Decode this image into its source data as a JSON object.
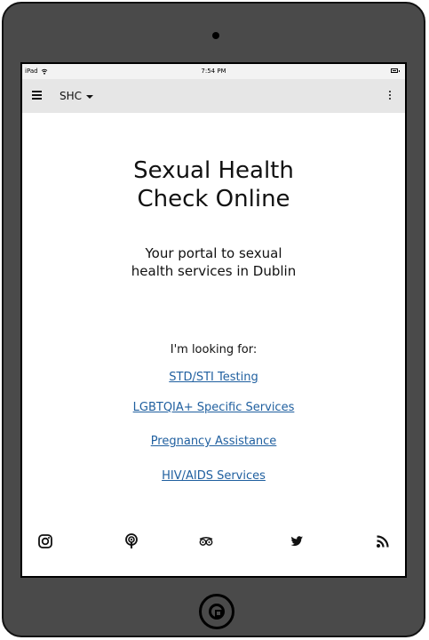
{
  "status_bar": {
    "carrier": "iPad",
    "time": "7:54 PM"
  },
  "app_bar": {
    "title": "SHC"
  },
  "main": {
    "heading_line1": "Sexual Health",
    "heading_line2": "Check Online",
    "subtitle_line1": "Your portal to sexual",
    "subtitle_line2": "health services in Dublin",
    "looking_for": "I'm looking for:",
    "links": [
      "STD/STI Testing",
      "LGBTQIA+ Specific Services",
      "Pregnancy Assistance",
      "HIV/AIDS Services"
    ]
  },
  "footer": {
    "icons": [
      "instagram-icon",
      "podcast-icon",
      "tripadvisor-icon",
      "twitter-icon",
      "rss-icon"
    ]
  },
  "colors": {
    "device": "#4a4a4a",
    "app_bar": "#e6e6e6",
    "link": "#1f5f9f"
  }
}
